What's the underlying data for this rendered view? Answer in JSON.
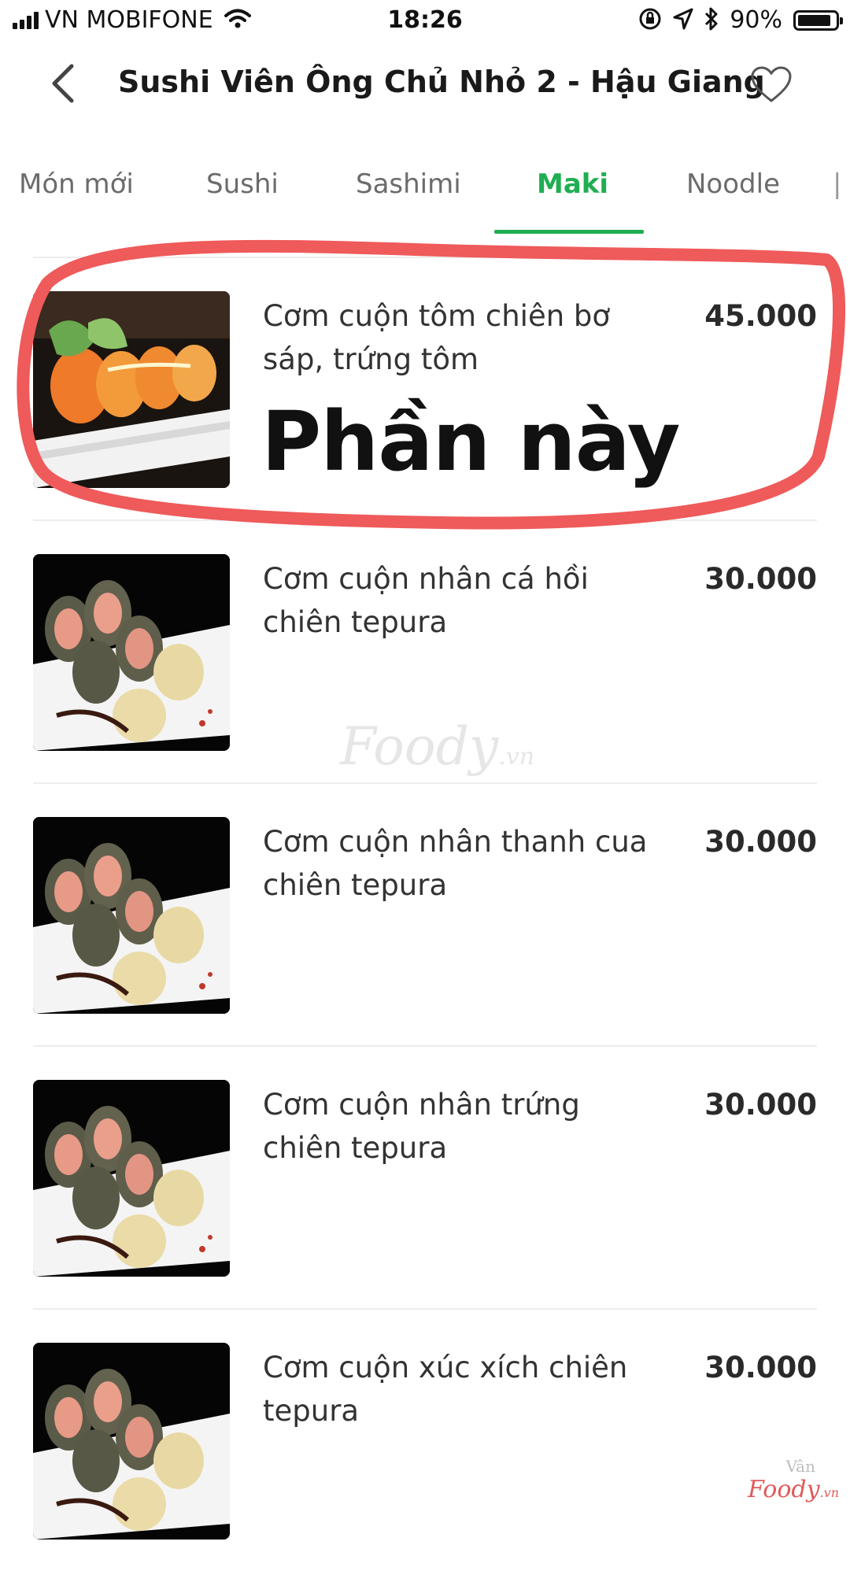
{
  "status_bar": {
    "carrier": "VN MOBIFONE",
    "time": "18:26",
    "battery_percent": "90%",
    "battery_level": 0.9
  },
  "header": {
    "title": "Sushi Viên Ông Chủ Nhỏ 2 - Hậu Giang",
    "icons": [
      "chevron-left-icon",
      "heart-outline-icon"
    ]
  },
  "tabs": [
    {
      "label": "Món mới",
      "active": false
    },
    {
      "label": "Sushi",
      "active": false
    },
    {
      "label": "Sashimi",
      "active": false
    },
    {
      "label": "Maki",
      "active": true
    },
    {
      "label": "Noodle",
      "active": false
    }
  ],
  "colors": {
    "accent": "#1fae52",
    "annotation": "#ef5a5a"
  },
  "items": [
    {
      "name": "Cơm cuộn tôm chiên bơ sáp, trứng tôm",
      "price": "45.000"
    },
    {
      "name": "Cơm cuộn nhân cá hồi chiên tepura",
      "price": "30.000"
    },
    {
      "name": "Cơm cuộn nhân thanh cua chiên tepura",
      "price": "30.000"
    },
    {
      "name": "Cơm cuộn nhân trứng chiên tepura",
      "price": "30.000"
    },
    {
      "name": "Cơm cuộn xúc xích chiên tepura",
      "price": "30.000"
    }
  ],
  "overlay_note": "Phần này",
  "watermark": {
    "brand": "Foody",
    "suffix": ".vn",
    "signature": "Vân"
  }
}
